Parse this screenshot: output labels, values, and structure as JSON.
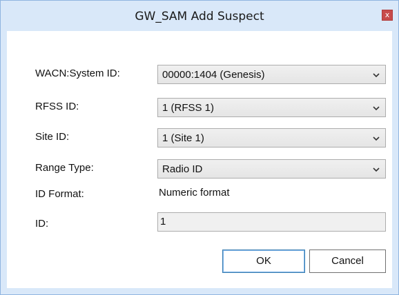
{
  "dialog": {
    "title": "GW_SAM Add Suspect",
    "close_label": "x"
  },
  "form": {
    "wacn": {
      "label": "WACN:System ID:",
      "value": "00000:1404 (Genesis)"
    },
    "rfss": {
      "label": "RFSS ID:",
      "value": "1 (RFSS 1)"
    },
    "site": {
      "label": "Site ID:",
      "value": "1 (Site 1)"
    },
    "range_type": {
      "label": "Range Type:",
      "value": "Radio ID"
    },
    "id_format": {
      "label": "ID Format:",
      "value": "Numeric format"
    },
    "id": {
      "label": "ID:",
      "value": "1"
    }
  },
  "buttons": {
    "ok": "OK",
    "cancel": "Cancel"
  },
  "icons": {
    "combo_arrow": "chevron-down-icon",
    "close": "close-icon"
  },
  "colors": {
    "titlebar": "#d9e8f9",
    "close_button": "#c74b4b",
    "field_border": "#acacac"
  }
}
